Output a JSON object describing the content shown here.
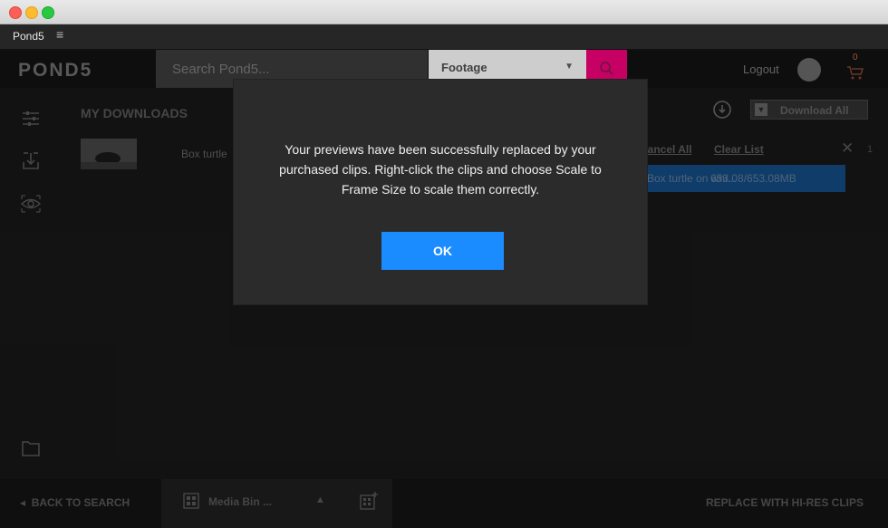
{
  "window": {
    "panel_tab": "Pond5",
    "panel_menu_icon": "≡"
  },
  "header": {
    "logo": "POND5",
    "search_placeholder": "Search Pond5...",
    "category": "Footage",
    "logout": "Logout",
    "cart_count": "0"
  },
  "downloads": {
    "title": "MY DOWNLOADS",
    "download_all": "Download All",
    "cancel_all": "Cancel All",
    "clear_list": "Clear List",
    "item": {
      "name": "Box turtle",
      "file": "Box turtle on whi...",
      "size": "653.08/653.08MB",
      "progress": 1.0
    },
    "side_number": "1"
  },
  "bottom": {
    "back_to_search": "BACK TO SEARCH",
    "bin_label": "Media Bin ...",
    "replace_hires": "REPLACE WITH HI-RES CLIPS"
  },
  "modal": {
    "message": "Your previews have been successfully replaced by your purchased clips. Right-click the clips and choose Scale to Frame Size to scale them correctly.",
    "ok_label": "OK"
  },
  "colors": {
    "accent_pink": "#d2006a",
    "ok_blue": "#1a8cff",
    "progress_blue": "#0f3a66"
  }
}
